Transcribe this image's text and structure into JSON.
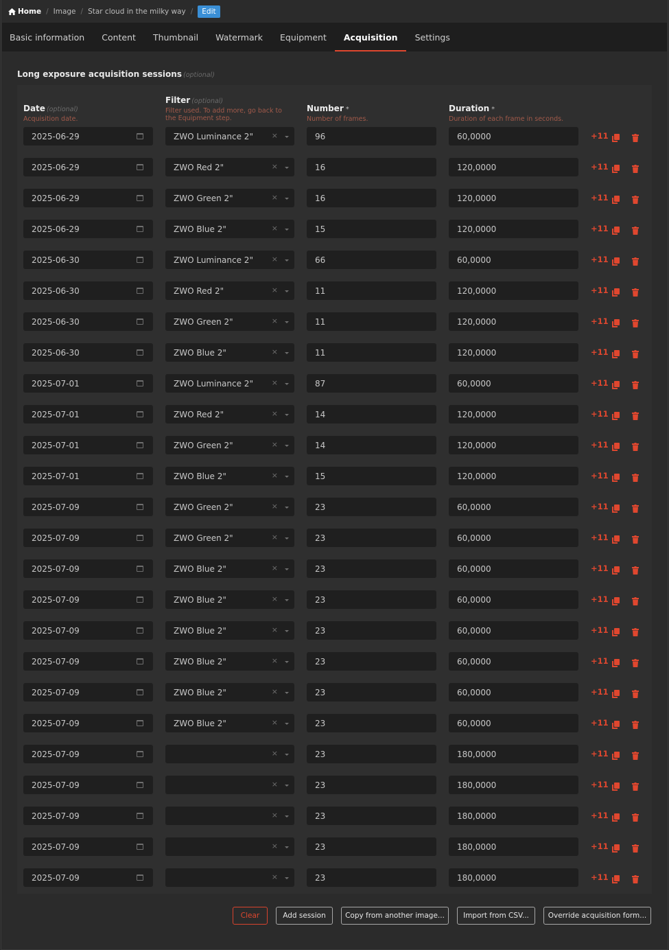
{
  "breadcrumb": {
    "home": "Home",
    "items": [
      "Image",
      "Star cloud in the milky way"
    ],
    "edit": "Edit"
  },
  "tabs": [
    "Basic information",
    "Content",
    "Thumbnail",
    "Watermark",
    "Equipment",
    "Acquisition",
    "Settings"
  ],
  "active_tab": "Acquisition",
  "section": {
    "title": "Long exposure acquisition sessions",
    "optional": "(optional)"
  },
  "columns": {
    "date": {
      "label": "Date",
      "optional": "(optional)",
      "hint": "Acquisition date."
    },
    "filter": {
      "label": "Filter",
      "optional": "(optional)",
      "hint": "Filter used. To add more, go back to the Equipment step."
    },
    "number": {
      "label": "Number",
      "required": "*",
      "hint": "Number of frames."
    },
    "duration": {
      "label": "Duration",
      "required": "*",
      "hint": "Duration of each frame in seconds."
    }
  },
  "row_action_label": "+11",
  "rows": [
    {
      "date": "2025-06-29",
      "filter": "ZWO Luminance 2\"",
      "number": "96",
      "duration": "60,0000"
    },
    {
      "date": "2025-06-29",
      "filter": "ZWO Red 2\"",
      "number": "16",
      "duration": "120,0000"
    },
    {
      "date": "2025-06-29",
      "filter": "ZWO Green 2\"",
      "number": "16",
      "duration": "120,0000"
    },
    {
      "date": "2025-06-29",
      "filter": "ZWO Blue 2\"",
      "number": "15",
      "duration": "120,0000"
    },
    {
      "date": "2025-06-30",
      "filter": "ZWO Luminance 2\"",
      "number": "66",
      "duration": "60,0000"
    },
    {
      "date": "2025-06-30",
      "filter": "ZWO Red 2\"",
      "number": "11",
      "duration": "120,0000"
    },
    {
      "date": "2025-06-30",
      "filter": "ZWO Green 2\"",
      "number": "11",
      "duration": "120,0000"
    },
    {
      "date": "2025-06-30",
      "filter": "ZWO Blue 2\"",
      "number": "11",
      "duration": "120,0000"
    },
    {
      "date": "2025-07-01",
      "filter": "ZWO Luminance 2\"",
      "number": "87",
      "duration": "60,0000"
    },
    {
      "date": "2025-07-01",
      "filter": "ZWO Red 2\"",
      "number": "14",
      "duration": "120,0000"
    },
    {
      "date": "2025-07-01",
      "filter": "ZWO Green 2\"",
      "number": "14",
      "duration": "120,0000"
    },
    {
      "date": "2025-07-01",
      "filter": "ZWO Blue 2\"",
      "number": "15",
      "duration": "120,0000"
    },
    {
      "date": "2025-07-09",
      "filter": "ZWO Green 2\"",
      "number": "23",
      "duration": "60,0000"
    },
    {
      "date": "2025-07-09",
      "filter": "ZWO Green 2\"",
      "number": "23",
      "duration": "60,0000"
    },
    {
      "date": "2025-07-09",
      "filter": "ZWO Blue 2\"",
      "number": "23",
      "duration": "60,0000"
    },
    {
      "date": "2025-07-09",
      "filter": "ZWO Blue 2\"",
      "number": "23",
      "duration": "60,0000"
    },
    {
      "date": "2025-07-09",
      "filter": "ZWO Blue 2\"",
      "number": "23",
      "duration": "60,0000"
    },
    {
      "date": "2025-07-09",
      "filter": "ZWO Blue 2\"",
      "number": "23",
      "duration": "60,0000"
    },
    {
      "date": "2025-07-09",
      "filter": "ZWO Blue 2\"",
      "number": "23",
      "duration": "60,0000"
    },
    {
      "date": "2025-07-09",
      "filter": "ZWO Blue 2\"",
      "number": "23",
      "duration": "60,0000"
    },
    {
      "date": "2025-07-09",
      "filter": "",
      "number": "23",
      "duration": "180,0000"
    },
    {
      "date": "2025-07-09",
      "filter": "",
      "number": "23",
      "duration": "180,0000"
    },
    {
      "date": "2025-07-09",
      "filter": "",
      "number": "23",
      "duration": "180,0000"
    },
    {
      "date": "2025-07-09",
      "filter": "",
      "number": "23",
      "duration": "180,0000"
    },
    {
      "date": "2025-07-09",
      "filter": "",
      "number": "23",
      "duration": "180,0000"
    }
  ],
  "buttons": {
    "clear": "Clear",
    "add": "Add session",
    "copy": "Copy from another image...",
    "import": "Import from CSV...",
    "override": "Override acquisition form..."
  },
  "colors": {
    "accent": "#e0472f",
    "edit_badge": "#3a8fd6",
    "field_bg": "#1f1f1f",
    "page_bg": "#2b2b2b"
  }
}
